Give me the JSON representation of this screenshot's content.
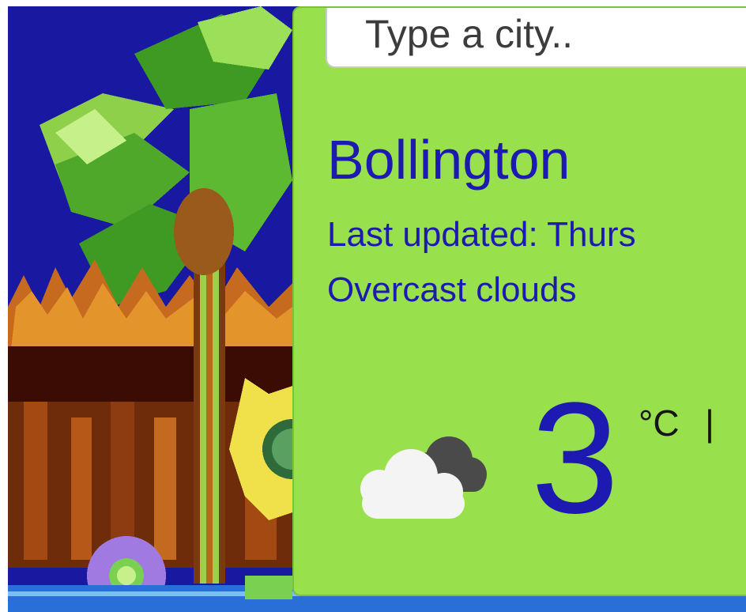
{
  "search": {
    "placeholder": "Type a city.."
  },
  "weather": {
    "city": "Bollington",
    "last_updated_prefix": "Last updated: Thurs",
    "description": "Overcast clouds",
    "temperature": "3",
    "unit_celsius": "°C",
    "unit_separator": "|",
    "icon": "overcast-clouds-icon"
  },
  "colors": {
    "card_background": "#98e04c",
    "text_accent": "#1c1ab0",
    "sky": "#1818a0"
  }
}
